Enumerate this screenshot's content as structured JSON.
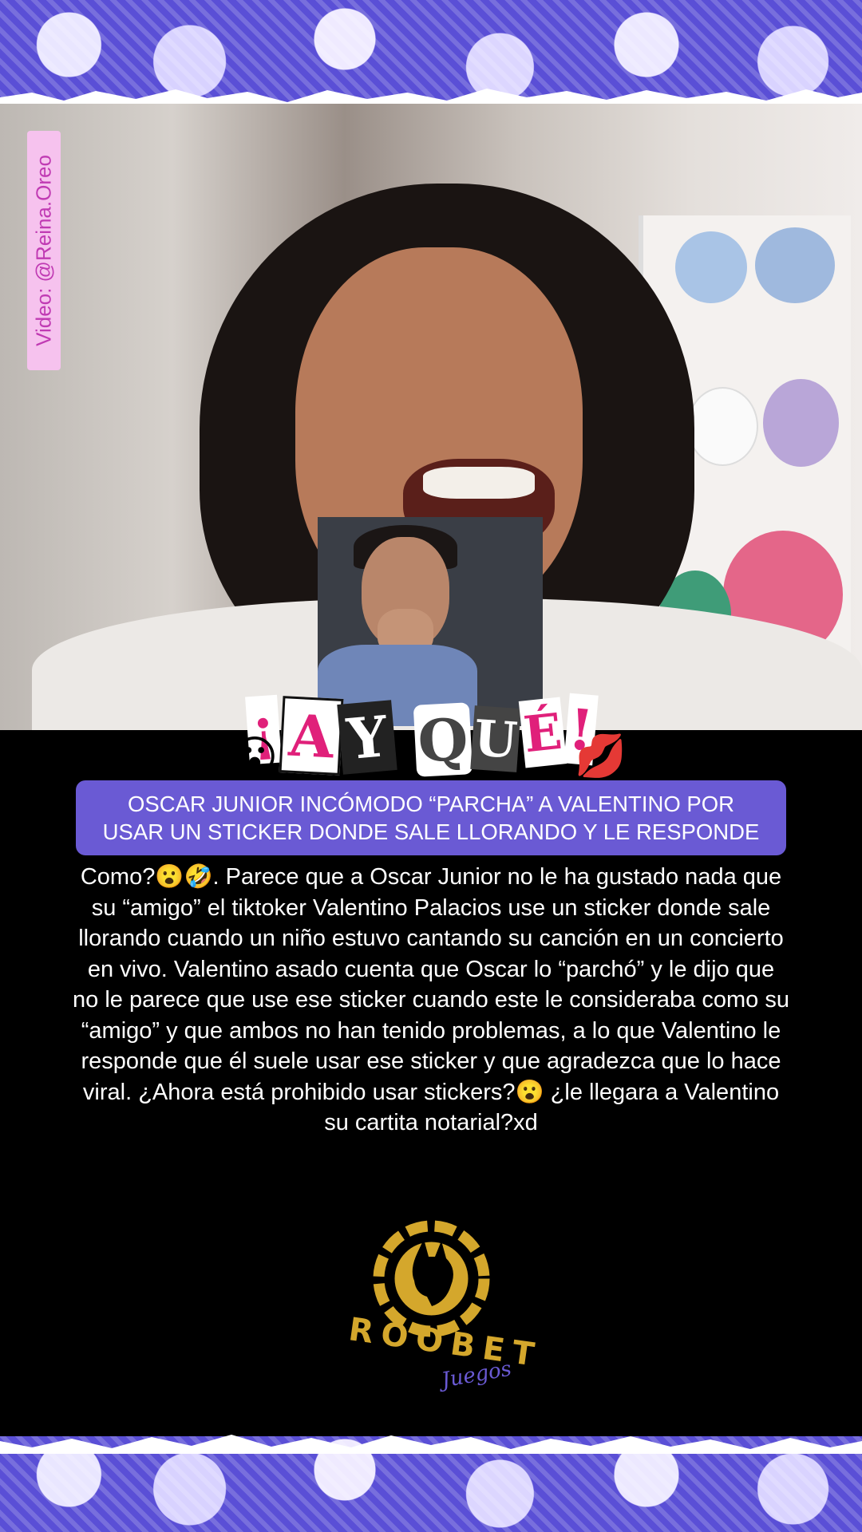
{
  "watermark": {
    "text": "Video: @Reina.Oreo"
  },
  "title_graphic": {
    "letters": [
      "¡",
      "A",
      "Y",
      "Q",
      "U",
      "É",
      "!"
    ],
    "emoji_left": "😮",
    "emoji_right": "💋"
  },
  "headline": {
    "line1": "OSCAR JUNIOR INCÓMODO “PARCHA” A VALENTINO POR",
    "line2": "USAR UN STICKER DONDE SALE LLORANDO Y LE RESPONDE"
  },
  "body": {
    "text": "Como?😮🤣. Parece que a Oscar Junior no le ha gustado nada que su “amigo” el tiktoker Valentino Palacios use un sticker donde sale llorando cuando un niño estuvo cantando su canción en un concierto en vivo. Valentino asado cuenta que Oscar lo “parchó” y le dijo que no le parece que use ese sticker cuando este le consideraba como su “amigo” y que ambos no han tenido problemas, a lo que Valentino le responde que él suele usar ese sticker y que agradezca que lo hace viral. ¿Ahora está prohibido usar stickers?😮 ¿le llegara a Valentino su cartita notarial?xd"
  },
  "logo": {
    "brand": "ROOBET",
    "sub": "Juegos"
  },
  "colors": {
    "purple": "#6a5ad4",
    "gold": "#d4a72c",
    "banner": "#5a4fd6",
    "watermark_bg": "#f6c2ee",
    "watermark_text": "#c03ab3"
  }
}
